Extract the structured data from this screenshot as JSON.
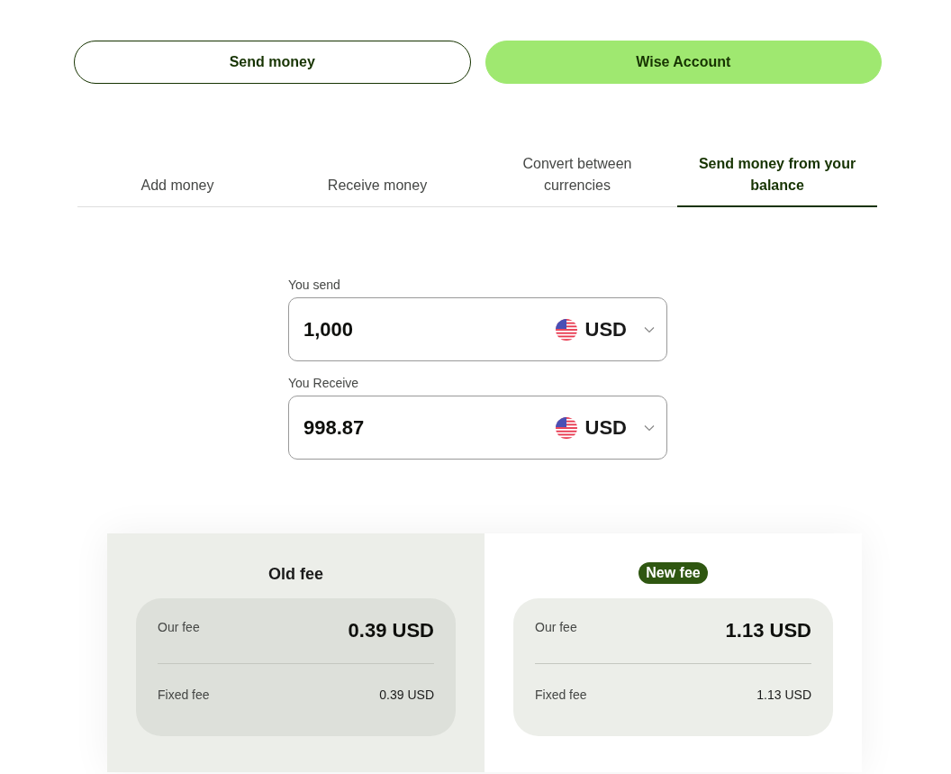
{
  "toggle": [
    {
      "label": "Send money",
      "selected": false
    },
    {
      "label": "Wise Account",
      "selected": true
    }
  ],
  "tabs": [
    {
      "label": "Add money",
      "selected": false
    },
    {
      "label": "Receive money",
      "selected": false
    },
    {
      "label": "Convert between currencies",
      "selected": false
    },
    {
      "label": "Send money from your balance",
      "selected": true
    }
  ],
  "fields": [
    {
      "label": "You send",
      "value": "1,000",
      "currency": "USD"
    },
    {
      "label": "You Receive",
      "value": "998.87",
      "currency": "USD"
    }
  ],
  "fees": [
    {
      "kind": "old",
      "title": "Old fee",
      "rows": [
        {
          "label": "Our fee",
          "value": "0.39 USD"
        },
        {
          "label": "Fixed fee",
          "value": "0.39 USD"
        }
      ]
    },
    {
      "kind": "new",
      "title": "New fee",
      "rows": [
        {
          "label": "Our fee",
          "value": "1.13 USD"
        },
        {
          "label": "Fixed fee",
          "value": "1.13 USD"
        }
      ]
    }
  ]
}
